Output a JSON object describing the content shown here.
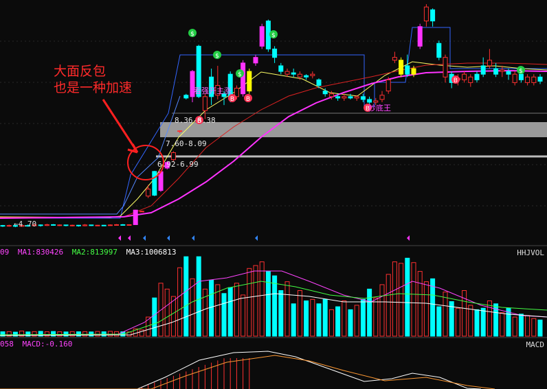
{
  "annotation": {
    "line1": "大面反包",
    "line2": "也是一种加速"
  },
  "price_labels": {
    "low": "←4.70",
    "zone1": "8.36-8.38",
    "zone2": "7.60-8.09",
    "zone3": "6.92-6.99",
    "chaodi": "抄底王",
    "qiangshi": "看强开主涨"
  },
  "volume_header": {
    "prefix": "09",
    "ma1": "MA1:830426",
    "ma2": "MA2:813997",
    "ma3": "MA3:1006813",
    "indicator": "HHJVOL"
  },
  "macd_header": {
    "prefix": "058",
    "macd": "MACD:-0.160",
    "indicator": "MACD"
  },
  "colors": {
    "up": "#ff3030",
    "down": "#00ffff",
    "magenta": "#ff33ff",
    "yellow": "#ffff00",
    "ma_yellow": "#ffff66",
    "ma_red": "#dd2222",
    "ma_magenta": "#ff33ff",
    "band_blue": "#3366ff",
    "zone_grey": "#9a9a9a"
  },
  "chart_data": {
    "type": "candlestick",
    "candles": [
      {
        "o": 5.0,
        "c": 4.98,
        "h": 5.02,
        "l": 4.95,
        "col": "down"
      },
      {
        "o": 4.98,
        "c": 5.0,
        "h": 5.03,
        "l": 4.96,
        "col": "up"
      },
      {
        "o": 5.0,
        "c": 4.97,
        "h": 5.01,
        "l": 4.94,
        "col": "down"
      },
      {
        "o": 4.97,
        "c": 5.0,
        "h": 5.02,
        "l": 4.95,
        "col": "up"
      },
      {
        "o": 5.0,
        "c": 4.99,
        "h": 5.04,
        "l": 4.96,
        "col": "down"
      },
      {
        "o": 4.99,
        "c": 5.02,
        "h": 5.06,
        "l": 4.97,
        "col": "up"
      },
      {
        "o": 5.02,
        "c": 5.0,
        "h": 5.04,
        "l": 4.96,
        "col": "down"
      },
      {
        "o": 5.0,
        "c": 5.03,
        "h": 5.06,
        "l": 4.98,
        "col": "up"
      },
      {
        "o": 5.03,
        "c": 5.01,
        "h": 5.05,
        "l": 4.99,
        "col": "down"
      },
      {
        "o": 5.01,
        "c": 5.02,
        "h": 5.04,
        "l": 4.98,
        "col": "up"
      },
      {
        "o": 5.02,
        "c": 5.0,
        "h": 5.03,
        "l": 4.97,
        "col": "down"
      },
      {
        "o": 5.0,
        "c": 5.01,
        "h": 5.03,
        "l": 4.97,
        "col": "up"
      },
      {
        "o": 5.01,
        "c": 4.99,
        "h": 5.02,
        "l": 4.96,
        "col": "down"
      },
      {
        "o": 4.99,
        "c": 5.02,
        "h": 5.05,
        "l": 4.97,
        "col": "up"
      },
      {
        "o": 5.02,
        "c": 5.0,
        "h": 5.03,
        "l": 4.98,
        "col": "down"
      },
      {
        "o": 5.0,
        "c": 5.01,
        "h": 5.02,
        "l": 4.98,
        "col": "up"
      },
      {
        "o": 5.01,
        "c": 5.0,
        "h": 5.02,
        "l": 4.98,
        "col": "down"
      },
      {
        "o": 5.0,
        "c": 5.02,
        "h": 5.04,
        "l": 4.99,
        "col": "up"
      },
      {
        "o": 5.02,
        "c": 5.03,
        "h": 5.05,
        "l": 5.0,
        "col": "up"
      },
      {
        "o": 5.03,
        "c": 5.02,
        "h": 5.05,
        "l": 5.0,
        "col": "down"
      },
      {
        "o": 5.02,
        "c": 5.03,
        "h": 5.04,
        "l": 5.0,
        "col": "up"
      },
      {
        "o": 5.03,
        "c": 5.55,
        "h": 5.56,
        "l": 5.03,
        "col": "magenta"
      },
      {
        "o": 5.5,
        "c": 5.51,
        "h": 5.53,
        "l": 5.48,
        "col": "up"
      },
      {
        "o": 6.3,
        "c": 6.05,
        "h": 6.45,
        "l": 5.98,
        "col": "up"
      },
      {
        "o": 6.08,
        "c": 6.93,
        "h": 6.95,
        "l": 6.05,
        "col": "down"
      },
      {
        "o": 6.25,
        "c": 6.92,
        "h": 6.96,
        "l": 6.2,
        "col": "magenta"
      },
      {
        "o": 7.05,
        "c": 7.25,
        "h": 7.3,
        "l": 7.0,
        "col": "magenta"
      },
      {
        "o": 7.35,
        "c": 7.6,
        "h": 7.65,
        "l": 7.3,
        "col": "up"
      },
      {
        "o": 8.36,
        "c": 8.38,
        "h": 8.4,
        "l": 8.3,
        "col": "up"
      },
      {
        "o": 9.55,
        "c": 9.65,
        "h": 9.7,
        "l": 9.5,
        "col": "down"
      },
      {
        "o": 9.6,
        "c": 10.5,
        "h": 10.55,
        "l": 9.4,
        "col": "magenta"
      },
      {
        "o": 11.4,
        "c": 9.6,
        "h": 11.45,
        "l": 9.55,
        "col": "down"
      },
      {
        "o": 9.1,
        "c": 9.6,
        "h": 9.7,
        "l": 8.8,
        "col": "up"
      },
      {
        "o": 9.6,
        "c": 10.3,
        "h": 10.6,
        "l": 9.3,
        "col": "down"
      },
      {
        "o": 10.0,
        "c": 9.65,
        "h": 10.7,
        "l": 9.5,
        "col": "up"
      },
      {
        "o": 9.6,
        "c": 9.7,
        "h": 9.8,
        "l": 9.3,
        "col": "down"
      },
      {
        "o": 9.6,
        "c": 10.4,
        "h": 10.5,
        "l": 9.4,
        "col": "down"
      },
      {
        "o": 9.6,
        "c": 9.9,
        "h": 10.0,
        "l": 9.5,
        "col": "up"
      },
      {
        "o": 9.7,
        "c": 10.8,
        "h": 10.9,
        "l": 9.6,
        "col": "magenta"
      },
      {
        "o": 9.8,
        "c": 10.5,
        "h": 10.6,
        "l": 9.7,
        "col": "yellow"
      },
      {
        "o": 10.8,
        "c": 11.0,
        "h": 11.1,
        "l": 10.7,
        "col": "magenta"
      },
      {
        "o": 12.1,
        "c": 11.4,
        "h": 12.2,
        "l": 11.3,
        "col": "magenta"
      },
      {
        "o": 12.3,
        "c": 11.3,
        "h": 12.35,
        "l": 11.2,
        "col": "down"
      },
      {
        "o": 11.3,
        "c": 11.0,
        "h": 11.4,
        "l": 10.8,
        "col": "down"
      },
      {
        "o": 10.7,
        "c": 10.5,
        "h": 10.8,
        "l": 10.4,
        "col": "down"
      },
      {
        "o": 10.5,
        "c": 10.4,
        "h": 10.6,
        "l": 10.3,
        "col": "up"
      },
      {
        "o": 10.4,
        "c": 10.45,
        "h": 10.6,
        "l": 10.3,
        "col": "down"
      },
      {
        "o": 10.4,
        "c": 10.3,
        "h": 10.5,
        "l": 10.2,
        "col": "up"
      },
      {
        "o": 10.3,
        "c": 10.35,
        "h": 10.4,
        "l": 10.2,
        "col": "down"
      },
      {
        "o": 10.35,
        "c": 10.4,
        "h": 10.5,
        "l": 10.25,
        "col": "up"
      },
      {
        "o": 10.2,
        "c": 10.0,
        "h": 10.25,
        "l": 9.9,
        "col": "down"
      },
      {
        "o": 9.8,
        "c": 9.7,
        "h": 9.9,
        "l": 9.6,
        "col": "down"
      },
      {
        "o": 9.7,
        "c": 9.6,
        "h": 9.8,
        "l": 9.5,
        "col": "up"
      },
      {
        "o": 9.6,
        "c": 9.55,
        "h": 9.7,
        "l": 9.45,
        "col": "down"
      },
      {
        "o": 9.55,
        "c": 9.6,
        "h": 9.7,
        "l": 9.45,
        "col": "up"
      },
      {
        "o": 9.6,
        "c": 9.55,
        "h": 9.7,
        "l": 9.5,
        "col": "down"
      },
      {
        "o": 9.55,
        "c": 9.6,
        "h": 9.65,
        "l": 9.45,
        "col": "up"
      },
      {
        "o": 9.6,
        "c": 9.5,
        "h": 9.7,
        "l": 9.4,
        "col": "down"
      },
      {
        "o": 9.5,
        "c": 9.4,
        "h": 9.6,
        "l": 9.3,
        "col": "down"
      },
      {
        "o": 9.4,
        "c": 9.45,
        "h": 9.55,
        "l": 9.3,
        "col": "up"
      },
      {
        "o": 9.5,
        "c": 9.65,
        "h": 9.8,
        "l": 9.4,
        "col": "up"
      },
      {
        "o": 9.8,
        "c": 10.2,
        "h": 10.3,
        "l": 9.7,
        "col": "up"
      },
      {
        "o": 11.0,
        "c": 10.9,
        "h": 11.2,
        "l": 10.8,
        "col": "up"
      },
      {
        "o": 10.9,
        "c": 10.4,
        "h": 11.0,
        "l": 10.3,
        "col": "yellow"
      },
      {
        "o": 10.7,
        "c": 10.4,
        "h": 11.1,
        "l": 10.3,
        "col": "down"
      },
      {
        "o": 10.4,
        "c": 10.6,
        "h": 10.7,
        "l": 10.3,
        "col": "yellow"
      },
      {
        "o": 12.1,
        "c": 11.4,
        "h": 12.2,
        "l": 11.3,
        "col": "magenta"
      },
      {
        "o": 12.8,
        "c": 12.3,
        "h": 12.9,
        "l": 12.1,
        "col": "up"
      },
      {
        "o": 12.3,
        "c": 12.7,
        "h": 12.75,
        "l": 12.1,
        "col": "down"
      },
      {
        "o": 11.5,
        "c": 11.0,
        "h": 11.6,
        "l": 10.9,
        "col": "down"
      },
      {
        "o": 11.0,
        "c": 10.3,
        "h": 11.1,
        "l": 10.1,
        "col": "up"
      },
      {
        "o": 10.4,
        "c": 10.1,
        "h": 10.5,
        "l": 9.9,
        "col": "down"
      },
      {
        "o": 10.2,
        "c": 10.25,
        "h": 10.4,
        "l": 10.0,
        "col": "up"
      },
      {
        "o": 10.2,
        "c": 10.4,
        "h": 10.5,
        "l": 10.1,
        "col": "up"
      },
      {
        "o": 10.3,
        "c": 10.1,
        "h": 10.4,
        "l": 9.95,
        "col": "up"
      },
      {
        "o": 10.2,
        "c": 10.4,
        "h": 10.5,
        "l": 10.1,
        "col": "down"
      },
      {
        "o": 10.4,
        "c": 10.7,
        "h": 11.0,
        "l": 10.3,
        "col": "down"
      },
      {
        "o": 10.7,
        "c": 10.9,
        "h": 11.3,
        "l": 10.6,
        "col": "up"
      },
      {
        "o": 10.6,
        "c": 10.4,
        "h": 10.8,
        "l": 10.3,
        "col": "down"
      },
      {
        "o": 10.5,
        "c": 10.55,
        "h": 10.7,
        "l": 10.3,
        "col": "up"
      },
      {
        "o": 10.5,
        "c": 10.4,
        "h": 10.6,
        "l": 10.2,
        "col": "down"
      },
      {
        "o": 10.4,
        "c": 10.1,
        "h": 10.5,
        "l": 10.0,
        "col": "up"
      },
      {
        "o": 10.2,
        "c": 10.4,
        "h": 10.5,
        "l": 10.1,
        "col": "down"
      },
      {
        "o": 10.3,
        "c": 10.1,
        "h": 10.4,
        "l": 10.0,
        "col": "up"
      },
      {
        "o": 10.1,
        "c": 10.3,
        "h": 10.4,
        "l": 10.0,
        "col": "up"
      },
      {
        "o": 10.3,
        "c": 10.15,
        "h": 10.4,
        "l": 10.05,
        "col": "down"
      }
    ],
    "volume": [
      60,
      62,
      55,
      70,
      58,
      62,
      66,
      60,
      64,
      60,
      58,
      62,
      60,
      62,
      58,
      64,
      60,
      66,
      62,
      60,
      58,
      100,
      85,
      260,
      520,
      720,
      640,
      540,
      930,
      1080,
      780,
      1080,
      640,
      760,
      700,
      580,
      660,
      720,
      560,
      920,
      960,
      1010,
      880,
      820,
      620,
      740,
      440,
      620,
      480,
      500,
      440,
      500,
      360,
      400,
      480,
      360,
      420,
      500,
      640,
      520,
      700,
      840,
      1010,
      990,
      1060,
      1000,
      880,
      740,
      780,
      400,
      600,
      470,
      380,
      620,
      420,
      360,
      380,
      480,
      440,
      320,
      380,
      260,
      300,
      280,
      240,
      220,
      200
    ],
    "price_ylim": [
      4.6,
      13.0
    ],
    "macd_label": "MACD:-0.160"
  }
}
